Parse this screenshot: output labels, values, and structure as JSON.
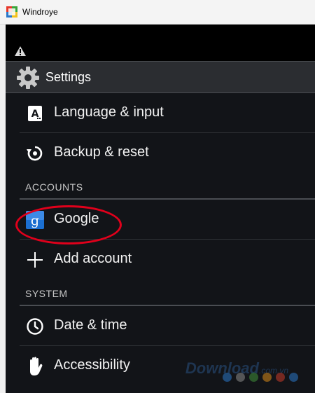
{
  "window": {
    "title": "Windroye"
  },
  "actionbar": {
    "title": "Settings",
    "icon": "gear-icon"
  },
  "statusbar": {
    "icon": "warning-icon"
  },
  "items": [
    {
      "label": "Language & input",
      "icon": "language-keyboard-icon"
    },
    {
      "label": "Backup & reset",
      "icon": "backup-reset-icon"
    }
  ],
  "accounts": {
    "header": "ACCOUNTS",
    "items": [
      {
        "label": "Google",
        "icon": "google-icon",
        "highlighted": true
      },
      {
        "label": "Add account",
        "icon": "plus-icon"
      }
    ]
  },
  "system": {
    "header": "SYSTEM",
    "items": [
      {
        "label": "Date & time",
        "icon": "clock-icon"
      },
      {
        "label": "Accessibility",
        "icon": "hand-icon"
      }
    ]
  },
  "watermark": {
    "text": "Download",
    "suffix": ".com.vn",
    "dot_colors": [
      "#2a77c9",
      "#8a8a8a",
      "#3f8f3a",
      "#d88a1a",
      "#c83b2a",
      "#2a77c9"
    ]
  },
  "colors": {
    "highlight": "#e0001b",
    "google_blue": "#1b6fd1"
  }
}
